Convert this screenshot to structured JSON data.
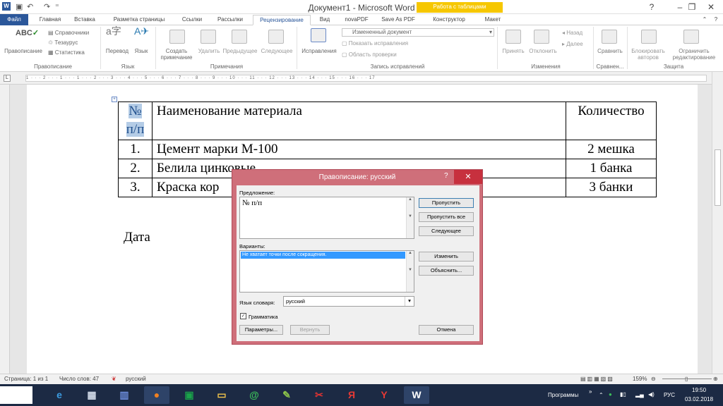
{
  "window": {
    "title": "Документ1 - Microsoft Word",
    "minimize": "–",
    "restore": "❐",
    "close": "✕"
  },
  "tabs": {
    "file": "Файл",
    "home": "Главная",
    "insert": "Вставка",
    "layout": "Разметка страницы",
    "refs": "Ссылки",
    "mailings": "Рассылки",
    "review": "Рецензирование",
    "view": "Вид",
    "novapdf": "novaPDF",
    "saveaspdf": "Save As PDF",
    "constructor": "Конструктор",
    "maket": "Макет",
    "context": "Работа с таблицами"
  },
  "ribbon": {
    "spelling": "Правописание",
    "research": "Справочники",
    "thesaurus": "Тезаурус",
    "stats": "Статистика",
    "translate": "Перевод",
    "language": "Язык",
    "new_note": "Создать примечание",
    "delete": "Удалить",
    "prev": "Предыдущее",
    "next": "Следующее",
    "tracking": "Исправления",
    "markup_select": "Измененный документ",
    "show_markup": "Показать исправления",
    "review_pane": "Область проверки",
    "accept": "Принять",
    "reject": "Отклонить",
    "prev_change": "Назад",
    "next_change": "Далее",
    "compare": "Сравнить",
    "block": "Блокировать авторов",
    "restrict": "Ограничить редактирование",
    "g_proofing": "Правописание",
    "g_language": "Язык",
    "g_comments": "Примечания",
    "g_tracking": "Запись исправлений",
    "g_changes": "Изменения",
    "g_compare": "Сравнен...",
    "g_protect": "Защита"
  },
  "ruler": {
    "text": "1 · · · 2 · · · 1 · · · 1 · · · 2 · · · 3 · · · 4 · · · 5 · · · 6 · · · 7 · · · 8 · · · 9 · · · 10 · · · 11 · · · 12 · · · 13 · · · 14 · · · 15 · · · 16 · · · 17"
  },
  "document": {
    "header": {
      "num": "№",
      "num2": "п/п",
      "name": "Наименование материала",
      "qty": "Количество"
    },
    "rows": [
      {
        "num": "1.",
        "name": "Цемент марки М-100",
        "qty": "2 мешка"
      },
      {
        "num": "2.",
        "name": "Белила цинковые",
        "qty": "1 банка"
      },
      {
        "num": "3.",
        "name": "Краска кор",
        "qty": "3 банки"
      }
    ],
    "date": "Дата"
  },
  "dialog": {
    "title": "Правописание: русский",
    "help": "?",
    "close": "✕",
    "sentence_label": "Предложение:",
    "sentence": "№ п/п",
    "variants_label": "Варианты:",
    "variant": "Не хватает точки после сокращения.",
    "dict_label": "Язык словаря:",
    "dict_value": "русский",
    "grammar": "Грамматика",
    "skip": "Пропустить",
    "skip_all": "Пропустить все",
    "next": "Следующее",
    "change": "Изменить",
    "explain": "Объяснить...",
    "options": "Параметры...",
    "undo": "Вернуть",
    "cancel": "Отмена"
  },
  "status": {
    "page": "Страница: 1 из 1",
    "words": "Число слов: 47",
    "lang": "русский",
    "zoom": "159%"
  },
  "taskbar": {
    "programs": "Программы",
    "lang": "РУС",
    "time": "19:50",
    "date": "03.02.2018"
  },
  "colors": {
    "word_blue": "#2b579a",
    "context_yellow": "#f6c700",
    "dialog_frame": "#cf6f7a",
    "taskbar": "#1c2a44"
  }
}
